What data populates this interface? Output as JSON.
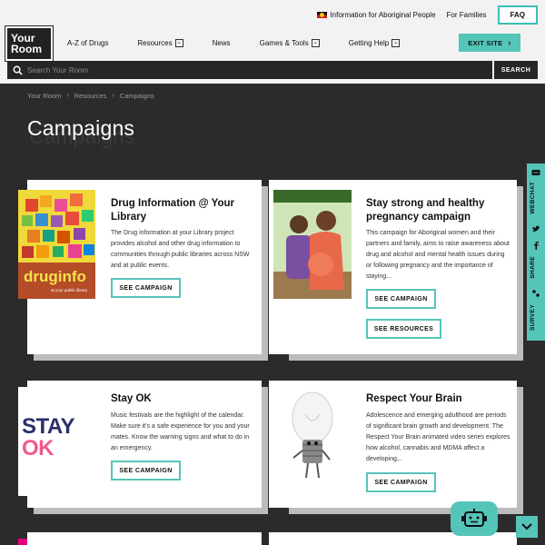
{
  "header": {
    "top_links": [
      "Information for Aboriginal People",
      "For Families"
    ],
    "faq_label": "FAQ",
    "logo_line1": "Your",
    "logo_line2": "Room",
    "nav": [
      {
        "label": "A-Z of Drugs"
      },
      {
        "label": "Resources"
      },
      {
        "label": "News"
      },
      {
        "label": "Games & Tools"
      },
      {
        "label": "Getting Help"
      }
    ],
    "exit_label": "EXIT SITE",
    "search_placeholder": "Search Your Room",
    "search_button": "SEARCH"
  },
  "breadcrumb": [
    "Your Room",
    "Resources",
    "Campaigns"
  ],
  "page_title": "Campaigns",
  "cards": [
    {
      "title": "Drug Information @ Your Library",
      "description": "The Drug information at your Library project provides alcohol and other drug information to communities through public libraries across NSW and at public events.",
      "buttons": [
        "SEE CAMPAIGN"
      ],
      "thumb_text": "druginfo",
      "thumb_caption": "at your public library"
    },
    {
      "title": "Stay strong and healthy pregnancy campaign",
      "description": "This campaign for Aboriginal women and their partners and family, aims to raise awareness about drug and alcohol and mental health issues during or following pregnancy and the importance of staying...",
      "buttons": [
        "SEE CAMPAIGN",
        "SEE RESOURCES"
      ]
    },
    {
      "title": "Stay OK",
      "description": "Music festivals are the highlight of the calendar. Make sure it's a safe experience for you and your mates. Know the warning signs and what to do in an emergency.",
      "buttons": [
        "SEE CAMPAIGN"
      ],
      "logo_word1": "STAY",
      "logo_word2": "OK"
    },
    {
      "title": "Respect Your Brain",
      "description": "Adolescence and emerging adulthood are periods of significant brain growth and development. The Respect Your Brain animated video series explores how alcohol, cannabis and MDMA affect a developing...",
      "buttons": [
        "SEE CAMPAIGN"
      ]
    }
  ],
  "sidebar": {
    "items": [
      {
        "label": "WEBCHAT",
        "icon": "chat-bubble-icon"
      },
      {
        "label": "SHARE",
        "icon": "share-icon"
      },
      {
        "label": "SURVEY",
        "icon": "survey-icon"
      }
    ]
  },
  "colors": {
    "accent": "#55c4b9",
    "background": "#2b2b2b",
    "header": "#f2f2f2"
  }
}
